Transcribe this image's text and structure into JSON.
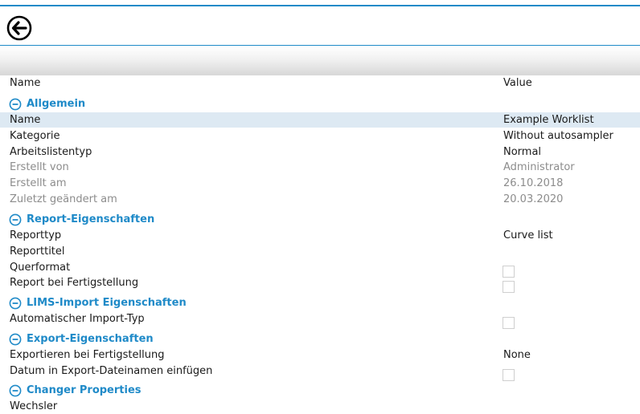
{
  "columns": {
    "name": "Name",
    "value": "Value"
  },
  "sections": [
    {
      "title": "Allgemein",
      "rows": [
        {
          "label": "Name",
          "value": "Example Worklist",
          "selected": true
        },
        {
          "label": "Kategorie",
          "value": "Without autosampler"
        },
        {
          "label": "Arbeitslistentyp",
          "value": "Normal"
        },
        {
          "label": "Erstellt von",
          "value": "Administrator",
          "readonly": true
        },
        {
          "label": "Erstellt am",
          "value": "26.10.2018",
          "readonly": true
        },
        {
          "label": "Zuletzt geändert am",
          "value": "20.03.2020",
          "readonly": true
        }
      ]
    },
    {
      "title": "Report-Eigenschaften",
      "rows": [
        {
          "label": "Reporttyp",
          "value": "Curve list"
        },
        {
          "label": "Reporttitel",
          "value": ""
        },
        {
          "label": "Querformat",
          "checkbox": true,
          "checked": false
        },
        {
          "label": "Report bei Fertigstellung",
          "checkbox": true,
          "checked": false
        }
      ]
    },
    {
      "title": "LIMS-Import Eigenschaften",
      "rows": [
        {
          "label": "Automatischer Import-Typ",
          "checkbox": true,
          "checked": false
        }
      ]
    },
    {
      "title": "Export-Eigenschaften",
      "rows": [
        {
          "label": "Exportieren bei Fertigstellung",
          "value": "None"
        },
        {
          "label": "Datum in Export-Dateinamen einfügen",
          "checkbox": true,
          "checked": false
        }
      ]
    },
    {
      "title": "Changer Properties",
      "rows": [
        {
          "label": "Wechsler",
          "value": ""
        }
      ]
    }
  ],
  "colors": {
    "accent": "#1f8ac8",
    "selected_row": "#dde9f3",
    "muted_text": "#8c8c8c"
  },
  "icons": {
    "back": "arrow-left-circle-icon",
    "collapse": "minus-circle-icon"
  }
}
